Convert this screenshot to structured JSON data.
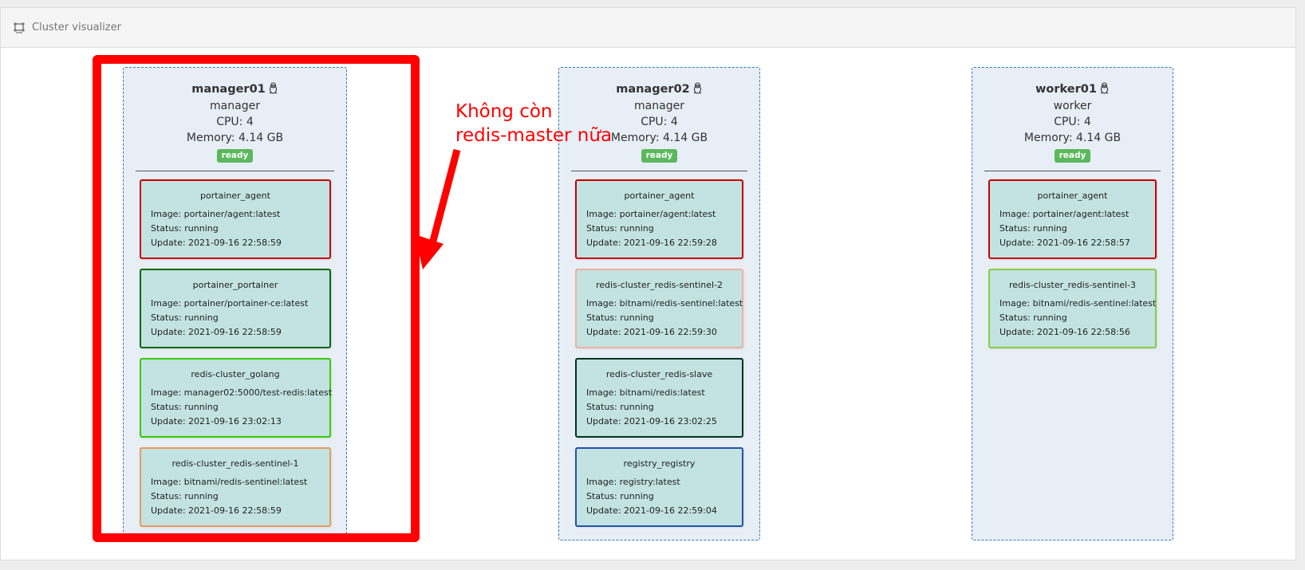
{
  "panel": {
    "title": "Cluster visualizer",
    "icon": "cluster-icon"
  },
  "colors": {
    "node_border": "#337ab7",
    "node_background": "#e7eef6",
    "task_background": "#c2e3e1",
    "ready_badge": "#5cb85c",
    "annotation": "#ff0000"
  },
  "nodes": [
    {
      "name": "manager01",
      "os_icon": "linux-icon",
      "role": "manager",
      "cpu": "CPU: 4",
      "memory": "Memory: 4.14 GB",
      "status": "ready",
      "tasks": [
        {
          "name": "portainer_agent",
          "image": "Image: portainer/agent:latest",
          "status": "Status: running",
          "update": "Update: 2021-09-16 22:58:59",
          "color": "#cc0000"
        },
        {
          "name": "portainer_portainer",
          "image": "Image: portainer/portainer-ce:latest",
          "status": "Status: running",
          "update": "Update: 2021-09-16 22:58:59",
          "color": "#006600"
        },
        {
          "name": "redis-cluster_golang",
          "image": "Image: manager02:5000/test-redis:latest",
          "status": "Status: running",
          "update": "Update: 2021-09-16 23:02:13",
          "color": "#33cc00"
        },
        {
          "name": "redis-cluster_redis-sentinel-1",
          "image": "Image: bitnami/redis-sentinel:latest",
          "status": "Status: running",
          "update": "Update: 2021-09-16 22:58:59",
          "color": "#e89a5a"
        }
      ]
    },
    {
      "name": "manager02",
      "os_icon": "linux-icon",
      "role": "manager",
      "cpu": "CPU: 4",
      "memory": "Memory: 4.14 GB",
      "status": "ready",
      "tasks": [
        {
          "name": "portainer_agent",
          "image": "Image: portainer/agent:latest",
          "status": "Status: running",
          "update": "Update: 2021-09-16 22:59:28",
          "color": "#cc0000"
        },
        {
          "name": "redis-cluster_redis-sentinel-2",
          "image": "Image: bitnami/redis-sentinel:latest",
          "status": "Status: running",
          "update": "Update: 2021-09-16 22:59:30",
          "color": "#f0b0a0"
        },
        {
          "name": "redis-cluster_redis-slave",
          "image": "Image: bitnami/redis:latest",
          "status": "Status: running",
          "update": "Update: 2021-09-16 23:02:25",
          "color": "#003322"
        },
        {
          "name": "registry_registry",
          "image": "Image: registry:latest",
          "status": "Status: running",
          "update": "Update: 2021-09-16 22:59:04",
          "color": "#2255aa"
        }
      ]
    },
    {
      "name": "worker01",
      "os_icon": "linux-icon",
      "role": "worker",
      "cpu": "CPU: 4",
      "memory": "Memory: 4.14 GB",
      "status": "ready",
      "tasks": [
        {
          "name": "portainer_agent",
          "image": "Image: portainer/agent:latest",
          "status": "Status: running",
          "update": "Update: 2021-09-16 22:58:57",
          "color": "#cc0000"
        },
        {
          "name": "redis-cluster_redis-sentinel-3",
          "image": "Image: bitnami/redis-sentinel:latest",
          "status": "Status: running",
          "update": "Update: 2021-09-16 22:58:56",
          "color": "#88cc44"
        }
      ]
    }
  ],
  "annotation": {
    "line1": "Không còn",
    "line2": "redis-master nữa"
  }
}
